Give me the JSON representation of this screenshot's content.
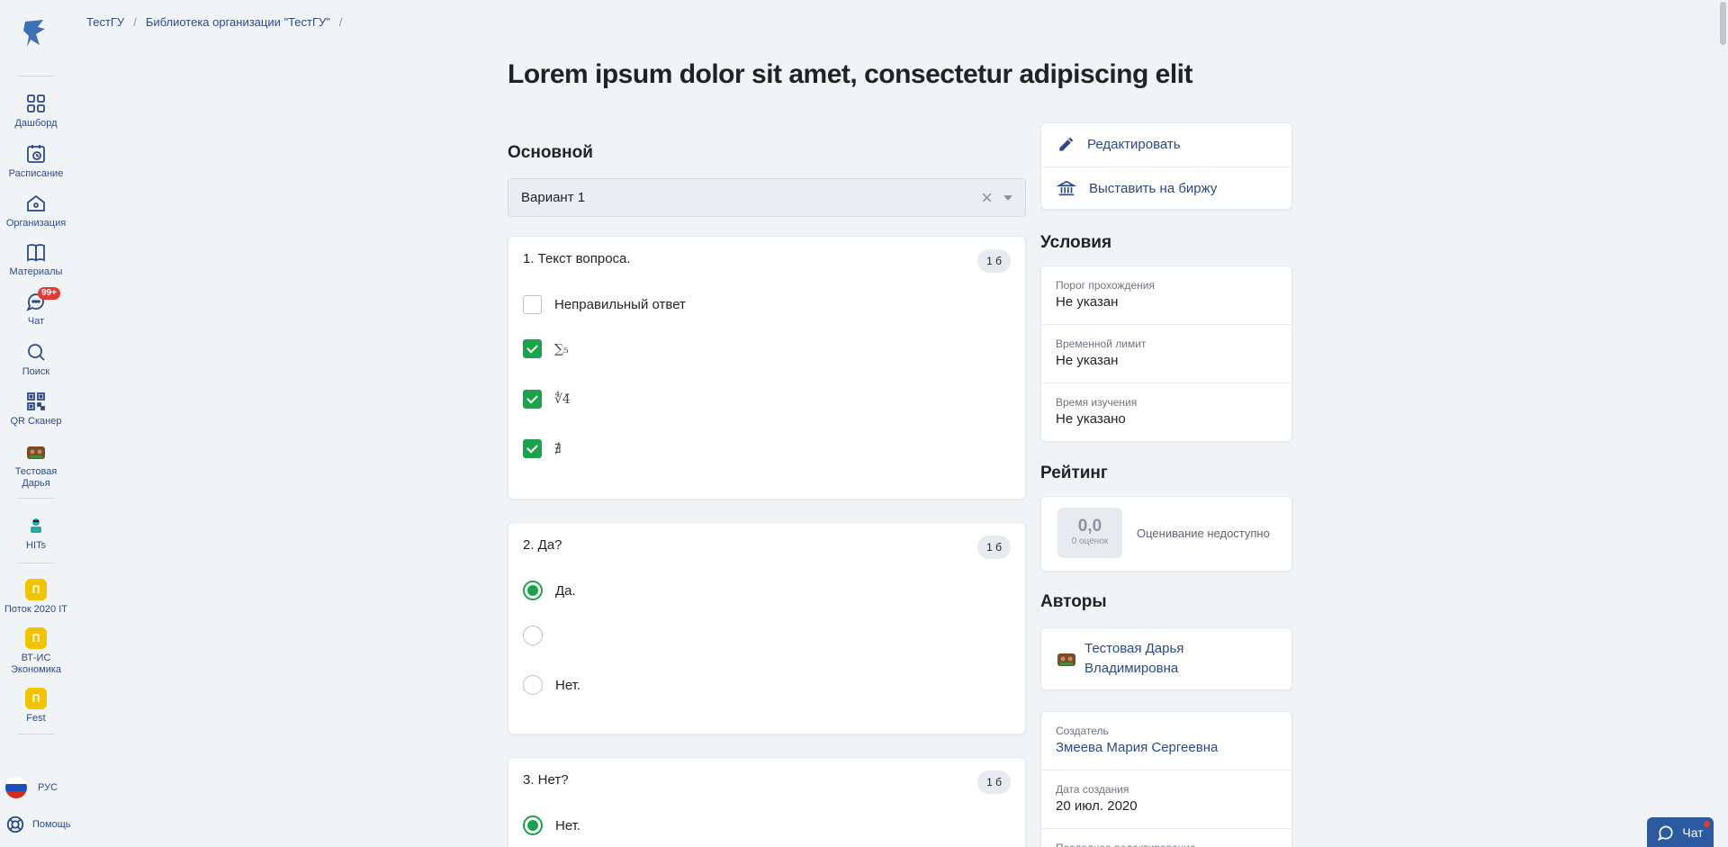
{
  "sidebar": {
    "items": [
      {
        "label": "Дашборд",
        "icon": "dashboard-icon"
      },
      {
        "label": "Расписание",
        "icon": "schedule-icon"
      },
      {
        "label": "Организация",
        "icon": "organization-icon"
      },
      {
        "label": "Материалы",
        "icon": "materials-icon"
      },
      {
        "label": "Чат",
        "icon": "chat-icon",
        "badge": "99+"
      },
      {
        "label": "Поиск",
        "icon": "search-icon"
      },
      {
        "label": "QR Сканер",
        "icon": "qr-icon"
      },
      {
        "label": "Тестовая Дарья",
        "icon": "user-avatar-icon"
      },
      {
        "label": "HITs",
        "icon": "hits-icon"
      }
    ],
    "groups": [
      {
        "letter": "П",
        "label": "Поток 2020 IT"
      },
      {
        "letter": "П",
        "label": "ВТ-ИС Экономика"
      },
      {
        "letter": "П",
        "label": "Fest"
      }
    ],
    "language": "РУС",
    "help": "Помощь"
  },
  "breadcrumb": {
    "items": [
      "ТестГУ",
      "Библиотека организации \"ТестГУ\""
    ],
    "separator": "/"
  },
  "page_title": "Lorem ipsum dolor sit amet, consectetur adipiscing elit",
  "main": {
    "section_title": "Основной",
    "variant_select": {
      "value": "Вариант 1"
    },
    "questions": [
      {
        "title": "1. Текст вопроса.",
        "score": "1 б",
        "options": [
          {
            "text": "Неправильный ответ",
            "checked": false
          },
          {
            "text": "∑₅",
            "checked": true
          },
          {
            "text": "∜4̄",
            "checked": true
          },
          {
            "text": "∄",
            "checked": true
          }
        ]
      },
      {
        "title": "2. Да?",
        "score": "1 б",
        "options": [
          {
            "text": "Да.",
            "selected": true
          },
          {
            "text": "",
            "selected": false
          },
          {
            "text": "Нет.",
            "selected": false
          }
        ]
      },
      {
        "title": "3. Нет?",
        "score": "1 б",
        "options": [
          {
            "text": "Нет.",
            "selected": true
          }
        ]
      }
    ]
  },
  "actions": {
    "edit": "Редактировать",
    "exchange": "Выставить на биржу"
  },
  "conditions": {
    "title": "Условия",
    "items": [
      {
        "key": "Порог прохождения",
        "value": "Не указан"
      },
      {
        "key": "Временной лимит",
        "value": "Не указан"
      },
      {
        "key": "Время изучения",
        "value": "Не указано"
      }
    ]
  },
  "rating": {
    "title": "Рейтинг",
    "value": "0,0",
    "count": "0 оценок",
    "note": "Оценивание недоступно"
  },
  "authors": {
    "title": "Авторы",
    "name": "Тестовая Дарья Владимировна"
  },
  "meta": {
    "items": [
      {
        "key": "Создатель",
        "value": "Змеева Мария Сергеевна"
      },
      {
        "key": "Дата создания",
        "value": "20 июл. 2020"
      },
      {
        "key": "Последнее редактирование",
        "value": ""
      }
    ]
  },
  "chat_button": "Чат",
  "colors": {
    "accent": "#2c4a8a",
    "success": "#1aa34a",
    "badge": "#e53935",
    "group": "#f2c400",
    "background": "#f1f4f7"
  }
}
